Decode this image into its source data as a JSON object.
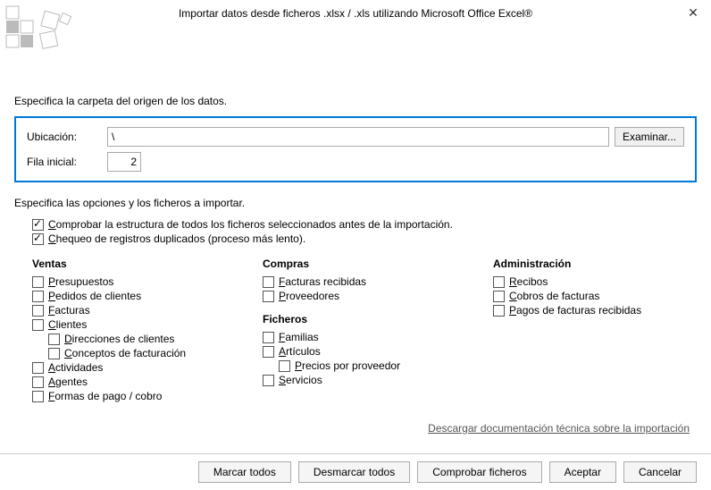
{
  "title": "Importar datos desde ficheros .xlsx / .xls utilizando Microsoft Office Excel®",
  "section_source_label": "Especifica la carpeta del origen de los datos.",
  "source": {
    "location_label": "Ubicación:",
    "location_value": "\\",
    "browse_label": "Examinar...",
    "initial_row_label": "Fila inicial:",
    "initial_row_value": "2"
  },
  "section_options_label": "Especifica las opciones y los ficheros a importar.",
  "options": {
    "check_structure": "Comprobar la estructura de todos los ficheros seleccionados antes de la importación.",
    "check_duplicates": "Chequeo de registros duplicados (proceso más lento)."
  },
  "columns": {
    "ventas": {
      "title": "Ventas",
      "items": [
        "Presupuestos",
        "Pedidos de clientes",
        "Facturas",
        "Clientes",
        "Direcciones de clientes",
        "Conceptos de facturación",
        "Actividades",
        "Agentes",
        "Formas de pago / cobro"
      ]
    },
    "compras": {
      "title": "Compras",
      "items": [
        "Facturas recibidas",
        "Proveedores"
      ]
    },
    "ficheros": {
      "title": "Ficheros",
      "items": [
        "Familias",
        "Artículos",
        "Precios por proveedor",
        "Servicios"
      ]
    },
    "admin": {
      "title": "Administración",
      "items": [
        "Recibos",
        "Cobros de facturas",
        "Pagos de facturas recibidas"
      ]
    }
  },
  "link": "Descargar documentación técnica sobre la importación",
  "buttons": {
    "mark_all": "Marcar todos",
    "unmark_all": "Desmarcar todos",
    "check_files": "Comprobar ficheros",
    "accept": "Aceptar",
    "cancel": "Cancelar"
  }
}
